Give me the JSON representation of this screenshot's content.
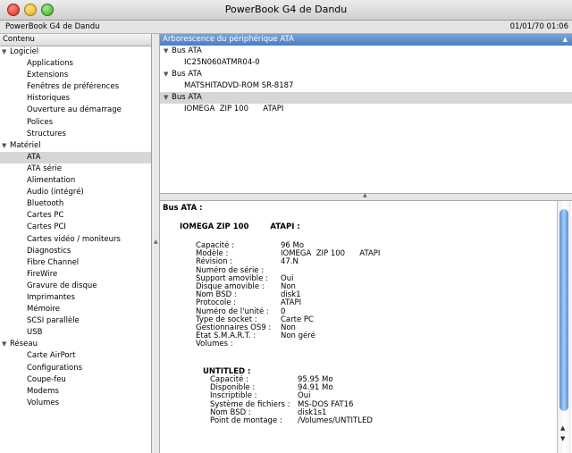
{
  "window": {
    "title": "PowerBook G4 de Dandu"
  },
  "infobar": {
    "machine": "PowerBook G4 de Dandu",
    "date": "01/01/70 01:06"
  },
  "sidebar": {
    "header": "Contenu",
    "items": [
      {
        "label": "Logiciel",
        "kind": "cat"
      },
      {
        "label": "Applications",
        "kind": "child"
      },
      {
        "label": "Extensions",
        "kind": "child"
      },
      {
        "label": "Fenêtres de préférences",
        "kind": "child"
      },
      {
        "label": "Historiques",
        "kind": "child"
      },
      {
        "label": "Ouverture au démarrage",
        "kind": "child"
      },
      {
        "label": "Polices",
        "kind": "child"
      },
      {
        "label": "Structures",
        "kind": "child"
      },
      {
        "label": "Matériel",
        "kind": "cat"
      },
      {
        "label": "ATA",
        "kind": "child",
        "selected": true
      },
      {
        "label": "ATA série",
        "kind": "child"
      },
      {
        "label": "Alimentation",
        "kind": "child"
      },
      {
        "label": "Audio (intégré)",
        "kind": "child"
      },
      {
        "label": "Bluetooth",
        "kind": "child"
      },
      {
        "label": "Cartes PC",
        "kind": "child"
      },
      {
        "label": "Cartes PCI",
        "kind": "child"
      },
      {
        "label": "Cartes vidéo / moniteurs",
        "kind": "child"
      },
      {
        "label": "Diagnostics",
        "kind": "child"
      },
      {
        "label": "Fibre Channel",
        "kind": "child"
      },
      {
        "label": "FireWire",
        "kind": "child"
      },
      {
        "label": "Gravure de disque",
        "kind": "child"
      },
      {
        "label": "Imprimantes",
        "kind": "child"
      },
      {
        "label": "Mémoire",
        "kind": "child"
      },
      {
        "label": "SCSI parallèle",
        "kind": "child"
      },
      {
        "label": "USB",
        "kind": "child"
      },
      {
        "label": "Réseau",
        "kind": "cat"
      },
      {
        "label": "Carte AirPort",
        "kind": "child"
      },
      {
        "label": "Configurations",
        "kind": "child"
      },
      {
        "label": "Coupe-feu",
        "kind": "child"
      },
      {
        "label": "Modems",
        "kind": "child"
      },
      {
        "label": "Volumes",
        "kind": "child"
      }
    ]
  },
  "tree": {
    "header": "Arborescence du périphérique ATA",
    "rows": [
      {
        "label": "Bus ATA",
        "level": 0
      },
      {
        "label": "IC25N060ATMR04-0",
        "level": 1
      },
      {
        "label": "Bus ATA",
        "level": 0
      },
      {
        "label": "MATSHITADVD-ROM SR-8187",
        "level": 1
      },
      {
        "label": "Bus ATA",
        "level": 0,
        "selected": true
      },
      {
        "label": "IOMEGA  ZIP 100      ATAPI",
        "level": 1
      }
    ]
  },
  "detail": {
    "title": "Bus ATA :",
    "device_name": "IOMEGA  ZIP 100",
    "device_type": "ATAPI :",
    "props": [
      {
        "k": "Capacité :",
        "v": "96 Mo"
      },
      {
        "k": "Modèle :",
        "v": "IOMEGA  ZIP 100      ATAPI"
      },
      {
        "k": "Révision :",
        "v": "47.N"
      },
      {
        "k": "Numéro de série :",
        "v": ""
      },
      {
        "k": "Support amovible :",
        "v": "Oui"
      },
      {
        "k": "Disque amovible :",
        "v": "Non"
      },
      {
        "k": "Nom BSD :",
        "v": "disk1"
      },
      {
        "k": "Protocole :",
        "v": "ATAPI"
      },
      {
        "k": "Numéro de l'unité :",
        "v": "0"
      },
      {
        "k": "Type de socket :",
        "v": "Carte PC"
      },
      {
        "k": "Gestionnaires OS9 :",
        "v": "Non"
      },
      {
        "k": "État S.M.A.R.T. :",
        "v": "Non géré"
      },
      {
        "k": "Volumes :",
        "v": ""
      }
    ],
    "volume": {
      "title": "UNTITLED :",
      "props": [
        {
          "k": "Capacité :",
          "v": "95.95 Mo"
        },
        {
          "k": "Disponible :",
          "v": "94.91 Mo"
        },
        {
          "k": "Inscriptible :",
          "v": "Oui"
        },
        {
          "k": "Système de fichiers :",
          "v": "MS-DOS FAT16"
        },
        {
          "k": "Nom BSD :",
          "v": "disk1s1"
        },
        {
          "k": "Point de montage :",
          "v": "/Volumes/UNTITLED"
        }
      ]
    }
  }
}
